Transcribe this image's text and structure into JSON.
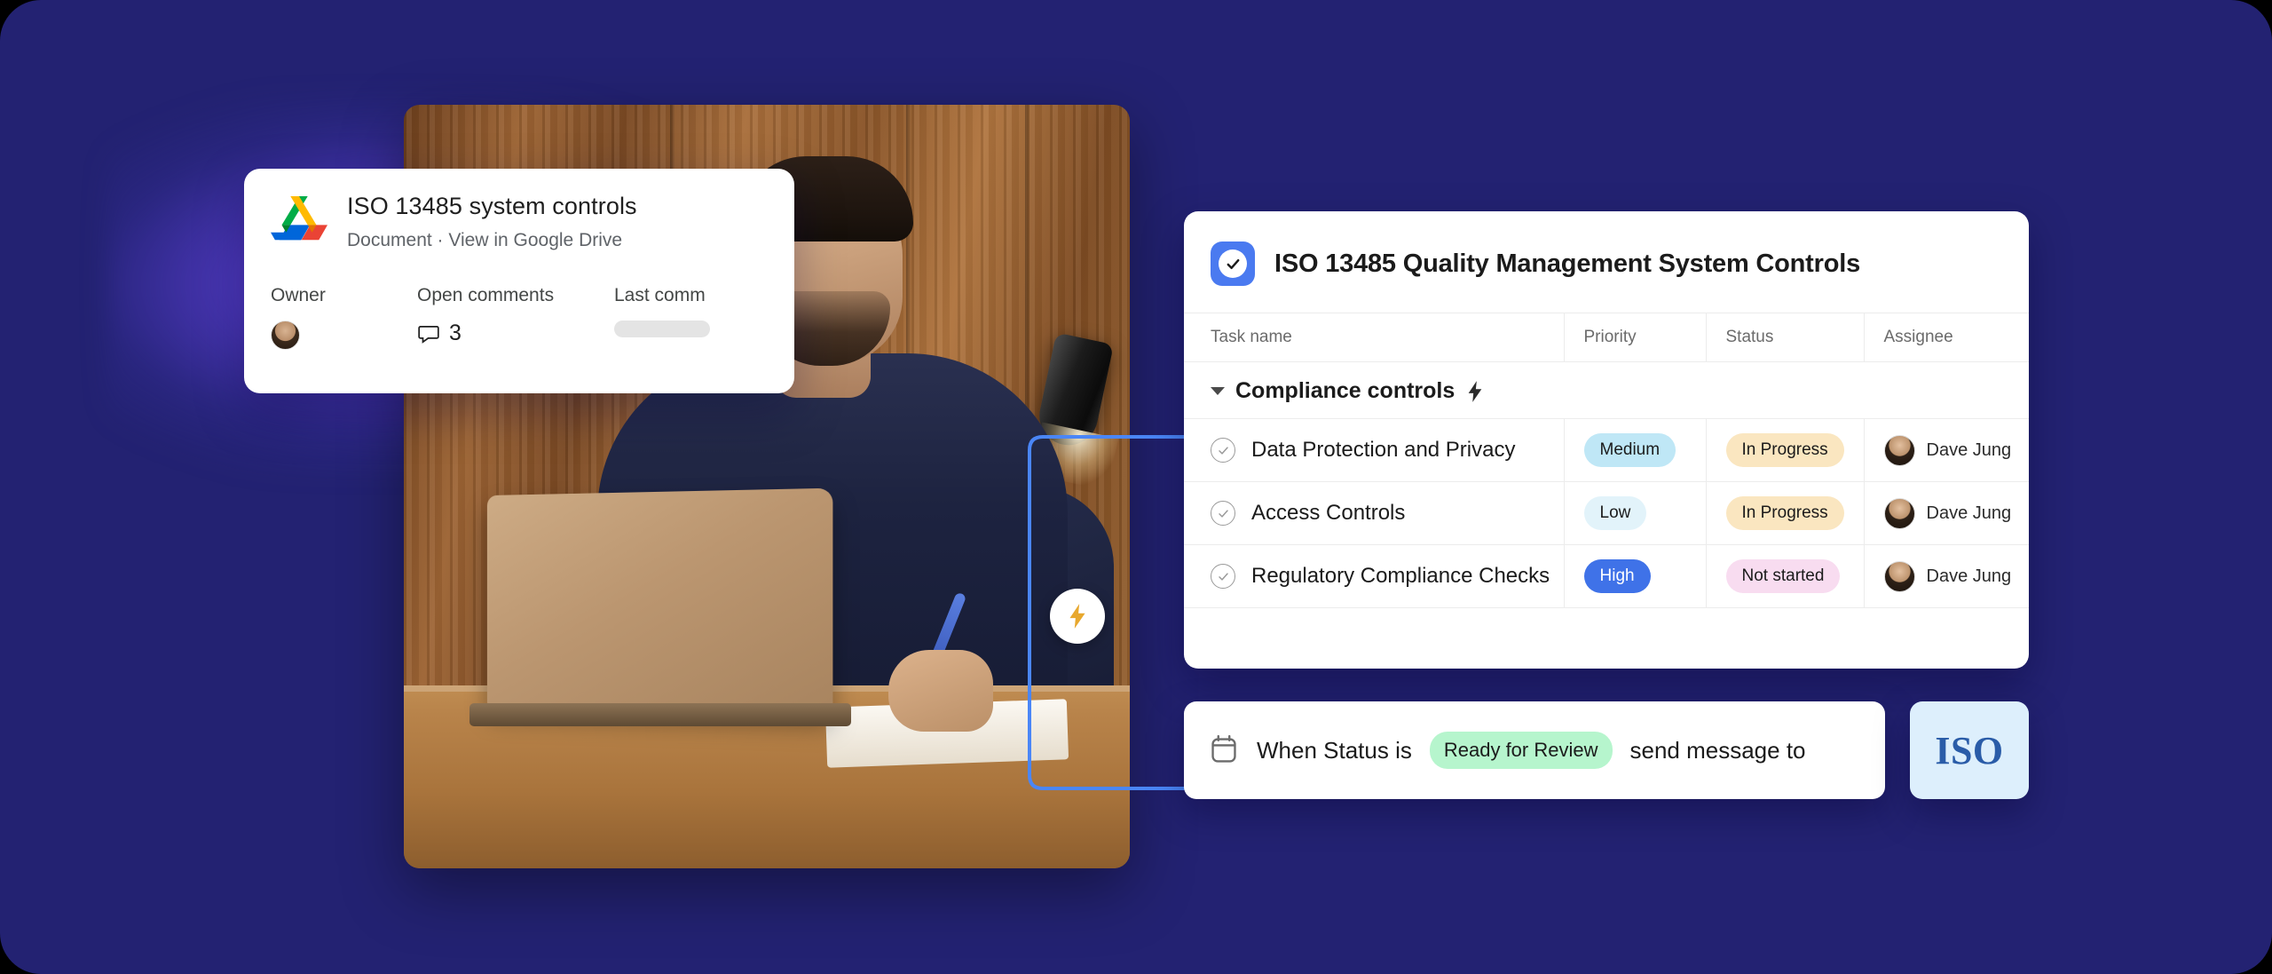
{
  "theme": {
    "background": "#232272",
    "accent_blue": "#4a7af0",
    "connector_blue": "#4a86f7",
    "glow_purple": "#7e58ff"
  },
  "drive_card": {
    "icon": "google-drive-icon",
    "title": "ISO 13485 system controls",
    "subtitle": "Document · View in Google Drive",
    "meta": {
      "owner_label": "Owner",
      "open_comments_label": "Open comments",
      "open_comments_count": "3",
      "last_comment_label": "Last comm"
    }
  },
  "connector": {
    "bolt_icon": "lightning-bolt-icon"
  },
  "task_card": {
    "checkbox_icon": "checkmark-icon",
    "title": "ISO 13485 Quality Management System Controls",
    "columns": [
      "Task name",
      "Priority",
      "Status",
      "Assignee"
    ],
    "section": {
      "label": "Compliance controls",
      "icon": "lightning-bolt-icon",
      "expanded": true
    },
    "rows": [
      {
        "name": "Data Protection and Privacy",
        "priority": "Medium",
        "priority_style": "bg-medium",
        "status": "In Progress",
        "status_style": "bg-prog",
        "assignee": "Dave Jung"
      },
      {
        "name": "Access Controls",
        "priority": "Low",
        "priority_style": "bg-low",
        "status": "In Progress",
        "status_style": "bg-prog",
        "assignee": "Dave Jung"
      },
      {
        "name": "Regulatory Compliance Checks",
        "priority": "High",
        "priority_style": "bg-high",
        "status": "Not started",
        "status_style": "bg-not",
        "assignee": "Dave Jung"
      }
    ]
  },
  "automation_card": {
    "icon": "calendar-icon",
    "text_before": "When Status is",
    "status_value": "Ready for Review",
    "text_after": "send message to"
  },
  "iso_badge": {
    "label": "ISO"
  }
}
